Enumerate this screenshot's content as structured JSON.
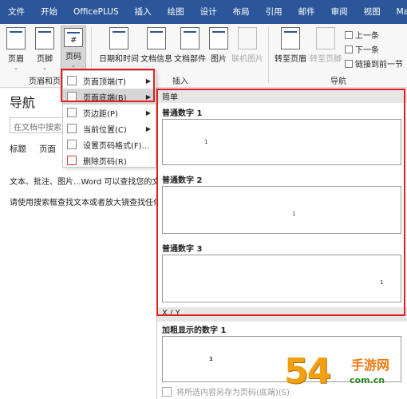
{
  "ribbon": {
    "tabs": [
      "文件",
      "开始",
      "OfficePLUS",
      "插入",
      "绘图",
      "设计",
      "布局",
      "引用",
      "邮件",
      "审阅",
      "视图",
      "Mat"
    ],
    "buttons": {
      "header": "页眉",
      "footer": "页脚",
      "page_number": "页码",
      "date_time": "日期和时间",
      "doc_info": "文档信息",
      "doc_parts": "文档部件",
      "picture": "图片",
      "online_picture": "联机图片",
      "goto_header": "转至页眉",
      "goto_footer": "转至页脚",
      "previous": "上一条",
      "next": "下一条",
      "link_previous": "链接到前一节"
    },
    "groups": {
      "header_footer": "页眉和页脚",
      "insert": "插入",
      "navigation": "导航"
    }
  },
  "nav_pane": {
    "title": "导航",
    "search_placeholder": "在文档中搜索",
    "tabs": [
      "标题",
      "页面"
    ],
    "hint1": "文本、批注、图片...Word 可以查找您的文档",
    "hint2": "请使用搜索框查找文本或者放大镜查找任何"
  },
  "page_number_menu": {
    "items": [
      {
        "label": "页面顶端(T)",
        "has_submenu": true
      },
      {
        "label": "页面底端(B)",
        "has_submenu": true
      },
      {
        "label": "页边距(P)",
        "has_submenu": true
      },
      {
        "label": "当前位置(C)",
        "has_submenu": true
      },
      {
        "label": "设置页码格式(F)...",
        "has_submenu": false
      },
      {
        "label": "删除页码(R)",
        "has_submenu": false
      }
    ],
    "highlighted": "页面底端(B)"
  },
  "gallery": {
    "section1": "简单",
    "items": [
      {
        "label": "普通数字 1",
        "align": "left",
        "num": "1"
      },
      {
        "label": "普通数字 2",
        "align": "center",
        "num": "1"
      },
      {
        "label": "普通数字 3",
        "align": "right",
        "num": "1"
      }
    ],
    "section2": "X / Y",
    "bold_item": {
      "label": "加粗显示的数字 1",
      "num": "1"
    },
    "footer_item": "将所选内容另存为页码(底端)(S)"
  },
  "watermark": {
    "big": "54",
    "cn": "手游网",
    "url": "com.cn"
  },
  "colors": {
    "accent": "#2b579a",
    "highlight_frame": "#e02020",
    "menu_hover": "#d6d6d6"
  }
}
